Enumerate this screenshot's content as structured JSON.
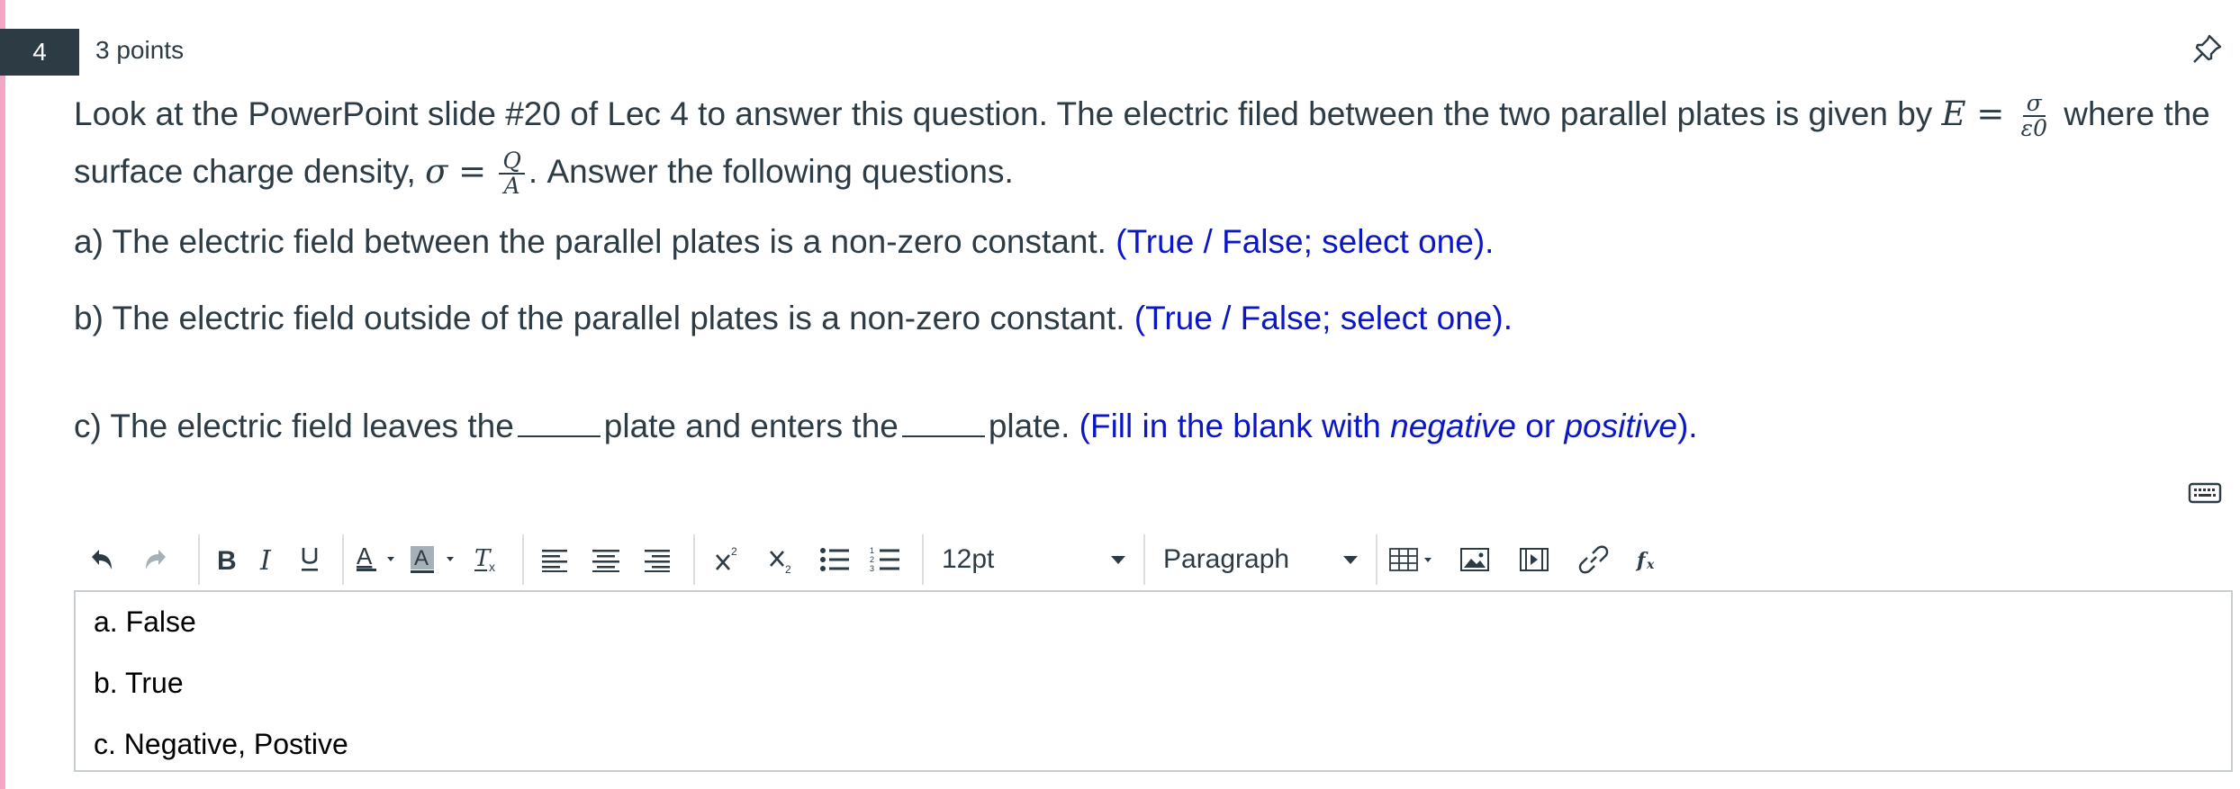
{
  "question": {
    "number": "4",
    "points": "3 points",
    "intro_1": "Look at the PowerPoint slide #20 of Lec 4 to answer this question. The electric filed between the two parallel plates is given by ",
    "eq1_lhs": "E =",
    "eq1_num": "σ",
    "eq1_den": "ε0",
    "intro_2": " where the",
    "intro_3": "surface charge density, ",
    "eq2_lhs": "σ =",
    "eq2_num": "Q",
    "eq2_den": "A",
    "intro_4": ". Answer the following questions.",
    "part_a": "a) The electric field between the parallel plates is a non-zero constant.",
    "part_a_hint": "(True / False; select one).",
    "part_b": "b) The electric field outside of the parallel plates is a non-zero constant.",
    "part_b_hint": "(True / False; select one).",
    "part_c_1": "c) The electric field leaves the",
    "part_c_2": "plate and enters the",
    "part_c_3": "plate.",
    "part_c_hint_1": "(Fill in the blank with ",
    "part_c_hint_neg": "negative",
    "part_c_hint_or": " or ",
    "part_c_hint_pos": "positive",
    "part_c_hint_2": ")."
  },
  "toolbar": {
    "font_size": "12pt",
    "block_format": "Paragraph",
    "icons": [
      "undo-icon",
      "redo-icon",
      "bold-icon",
      "italic-icon",
      "underline-icon",
      "text-color-icon",
      "background-color-icon",
      "clear-formatting-icon",
      "align-left-icon",
      "align-center-icon",
      "align-right-icon",
      "superscript-icon",
      "subscript-icon",
      "bullet-list-icon",
      "numbered-list-icon",
      "table-icon",
      "image-icon",
      "media-icon",
      "link-icon",
      "equation-icon"
    ]
  },
  "editor": {
    "lines": [
      "a. False",
      "b. True",
      "c. Negative, Postive"
    ]
  },
  "colors": {
    "accent_blue": "#0b16c4",
    "stripe_pink": "#f4a6c4",
    "number_badge": "#2d3b45"
  }
}
